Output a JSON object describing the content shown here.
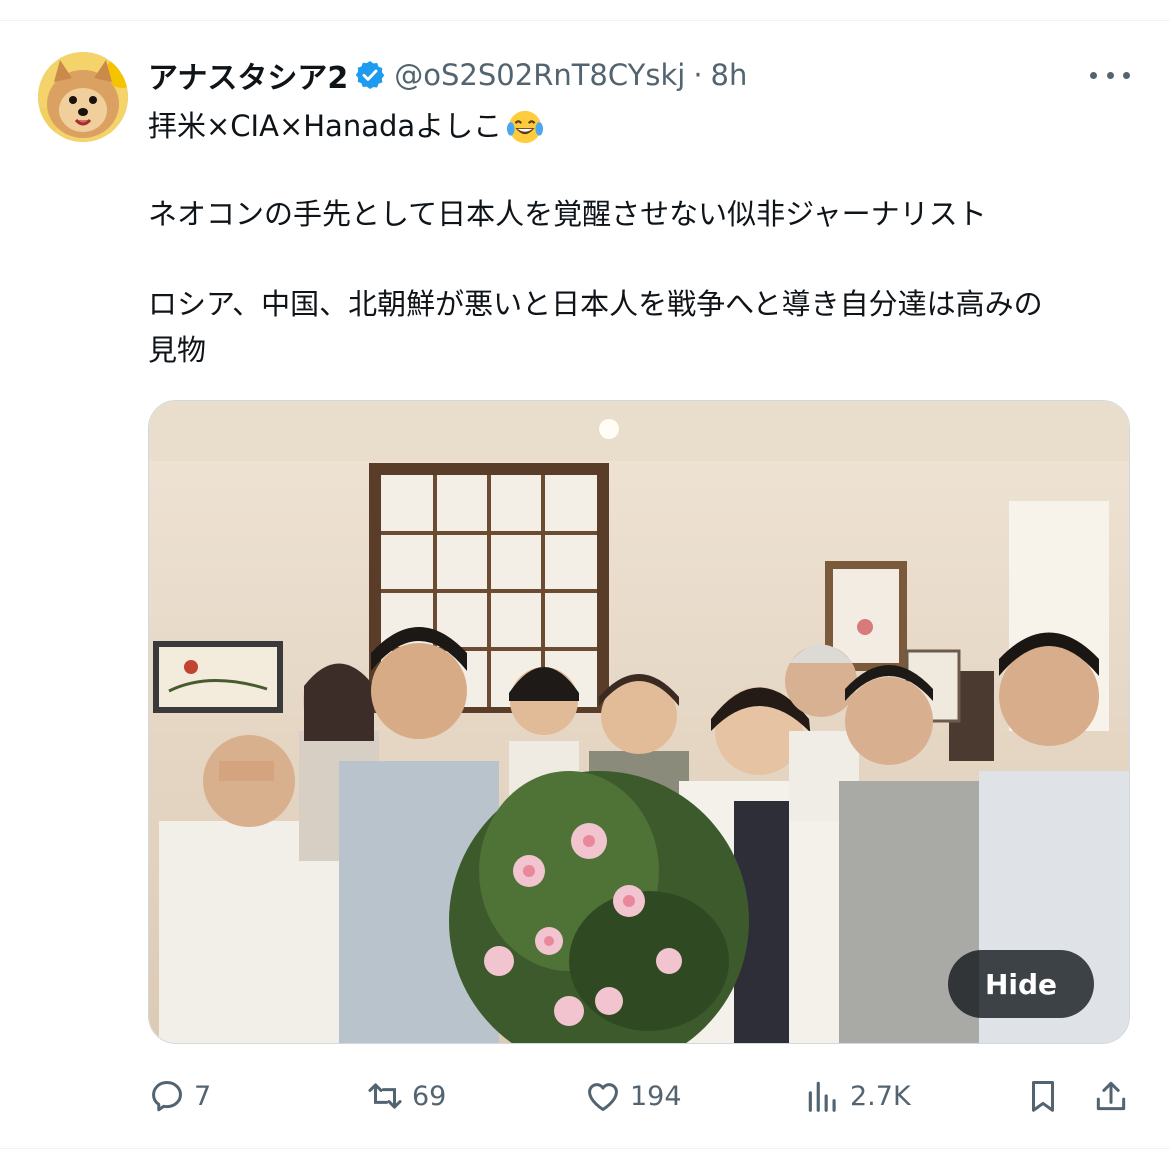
{
  "tweet": {
    "author_name": "アナスタシア2",
    "handle": "@oS2S02RnT8CYskj",
    "separator": "·",
    "time": "8h",
    "line1": "拝米×CIA×Hanadaよしこ",
    "line1_emoji": "face-with-tears-of-joy",
    "line2": "ネオコンの手先として日本人を覚醒させない似非ジャーナリスト",
    "line3": "ロシア、中国、北朝鮮が悪いと日本人を戦争へと導き自分達は高みの",
    "line4": "見物",
    "hide_label": "Hide"
  },
  "actions": {
    "replies": "7",
    "reposts": "69",
    "likes": "194",
    "views": "2.7K"
  },
  "colors": {
    "text": "#0f1419",
    "secondary": "#536471",
    "verified_blue": "#1d9bf0",
    "divider": "#eff3f4"
  }
}
